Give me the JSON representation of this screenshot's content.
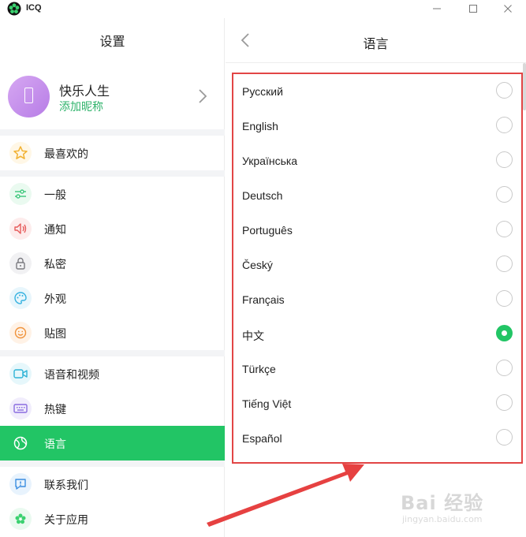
{
  "app": {
    "title": "ICQ",
    "logo_icon": "icq-flower-icon"
  },
  "window_controls": {
    "minimize_icon": "minimize-icon",
    "maximize_icon": "maximize-icon",
    "close_icon": "close-icon"
  },
  "left_panel": {
    "title": "设置",
    "profile": {
      "name": "快乐人生",
      "subtitle": "添加昵称"
    },
    "groups": [
      {
        "items": [
          {
            "label": "最喜欢的",
            "icon": "star-icon"
          }
        ]
      },
      {
        "items": [
          {
            "label": "一般",
            "icon": "sliders-icon"
          },
          {
            "label": "通知",
            "icon": "speaker-icon"
          },
          {
            "label": "私密",
            "icon": "lock-icon"
          },
          {
            "label": "外观",
            "icon": "palette-icon"
          },
          {
            "label": "贴图",
            "icon": "smiley-icon"
          }
        ]
      },
      {
        "items": [
          {
            "label": "语音和视频",
            "icon": "video-camera-icon"
          },
          {
            "label": "热键",
            "icon": "keyboard-icon"
          },
          {
            "label": "语言",
            "icon": "globe-icon",
            "active": true
          }
        ]
      },
      {
        "items": [
          {
            "label": "联系我们",
            "icon": "chat-alert-icon"
          },
          {
            "label": "关于应用",
            "icon": "icq-flower-icon"
          }
        ]
      }
    ]
  },
  "right_panel": {
    "title": "语言",
    "back_icon": "chevron-left-icon",
    "languages": [
      {
        "name": "Русский",
        "selected": false
      },
      {
        "name": "English",
        "selected": false
      },
      {
        "name": "Українська",
        "selected": false
      },
      {
        "name": "Deutsch",
        "selected": false
      },
      {
        "name": "Português",
        "selected": false
      },
      {
        "name": "Český",
        "selected": false
      },
      {
        "name": "Français",
        "selected": false
      },
      {
        "name": "中文",
        "selected": true
      },
      {
        "name": "Türkçe",
        "selected": false
      },
      {
        "name": "Tiếng Việt",
        "selected": false
      },
      {
        "name": "Español",
        "selected": false
      }
    ]
  },
  "watermark": {
    "text": "Bai 经验",
    "subtext": "jingyan.baidu.com"
  },
  "colors": {
    "accent_green": "#22c565",
    "highlight_border": "#e24545",
    "subtitle_green": "#2fb36b"
  }
}
